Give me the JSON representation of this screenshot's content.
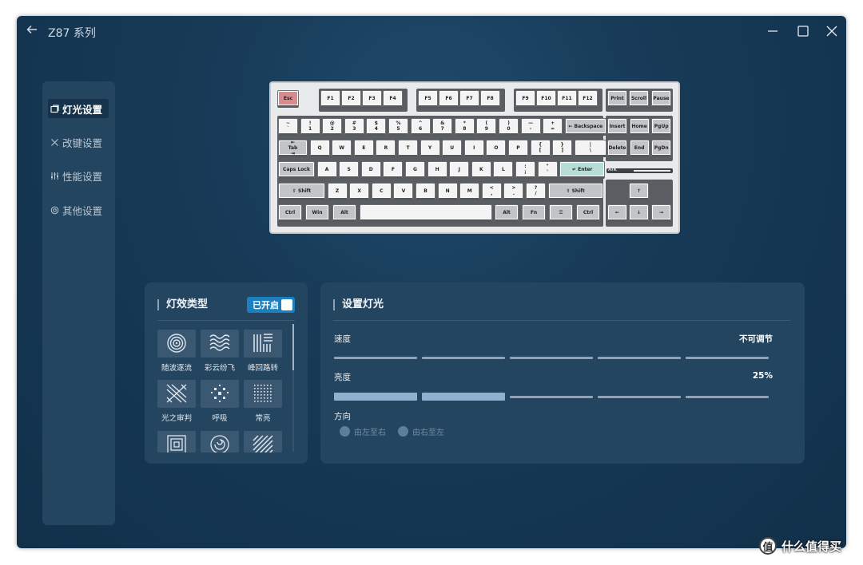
{
  "window": {
    "title": "Z87 系列",
    "controls": [
      "minimize-icon",
      "maximize-icon",
      "close-icon"
    ]
  },
  "sidebar": {
    "items": [
      {
        "label": "灯光设置",
        "icon": "light-icon",
        "active": true
      },
      {
        "label": "改键设置",
        "icon": "remap-icon",
        "active": false
      },
      {
        "label": "性能设置",
        "icon": "sliders-icon",
        "active": false
      },
      {
        "label": "其他设置",
        "icon": "gear-icon",
        "active": false
      }
    ]
  },
  "keyboard": {
    "logo_text": "ATK",
    "rows": {
      "fn": [
        "Esc",
        "F1",
        "F2",
        "F3",
        "F4",
        "F5",
        "F6",
        "F7",
        "F8",
        "F9",
        "F10",
        "F11",
        "F12",
        "Print",
        "Scroll",
        "Pause"
      ],
      "num": [
        "~\n`",
        "!\n1",
        "@\n2",
        "#\n3",
        "$\n4",
        "%\n5",
        "^\n6",
        "&\n7",
        "*\n8",
        "(\n9",
        ")\n0",
        "—\n-",
        "+\n=",
        "← Backspace",
        "Insert",
        "Home",
        "PgUp"
      ],
      "tab": [
        "⇤\nTab\n⇥",
        "Q",
        "W",
        "E",
        "R",
        "T",
        "Y",
        "U",
        "I",
        "O",
        "P",
        "{\n[",
        "}\n]",
        "|\n\\",
        "Delete",
        "End",
        "PgDn"
      ],
      "caps": [
        "Caps Lock",
        "A",
        "S",
        "D",
        "F",
        "G",
        "H",
        "J",
        "K",
        "L",
        ":\n;",
        "\"\n'",
        "↵ Enter"
      ],
      "shift": [
        "⇧ Shift",
        "Z",
        "X",
        "C",
        "V",
        "B",
        "N",
        "M",
        "<\n,",
        ">\n.",
        "?\n/",
        "⇧ Shift",
        "↑"
      ],
      "bottom": [
        "Ctrl",
        "Win",
        "Alt",
        "",
        "Alt",
        "Fn",
        "☰",
        "Ctrl",
        "←",
        "↓",
        "→"
      ]
    }
  },
  "effects_panel": {
    "title": "灯效类型",
    "toggle_label": "已开启",
    "toggle_on": true,
    "effects": [
      {
        "label": "随波逐流",
        "icon": "ripple-icon"
      },
      {
        "label": "彩云纷飞",
        "icon": "wave-icon"
      },
      {
        "label": "峰回路转",
        "icon": "maze-icon"
      },
      {
        "label": "光之审判",
        "icon": "cross-icon"
      },
      {
        "label": "呼吸",
        "icon": "breath-icon"
      },
      {
        "label": "常亮",
        "icon": "dots-icon"
      },
      {
        "label": "",
        "icon": "square-ripple-icon"
      },
      {
        "label": "",
        "icon": "swirl-icon"
      },
      {
        "label": "",
        "icon": "diagonal-icon"
      }
    ]
  },
  "light_panel": {
    "title": "设置灯光",
    "speed": {
      "label": "速度",
      "value": "不可调节",
      "segments": 5,
      "level": 0
    },
    "brightness": {
      "label": "亮度",
      "value": "25%",
      "segments": 5,
      "level": 2
    },
    "direction": {
      "label": "方向",
      "options": [
        "由左至右",
        "由右至左"
      ]
    }
  },
  "watermark": {
    "logo": "值",
    "text": "什么值得买"
  },
  "colors": {
    "background": "#173a57",
    "panel": "#244560",
    "accent": "#1b7fc0",
    "esc_key": "#d98a8f",
    "enter_key": "#b7ddd8"
  }
}
